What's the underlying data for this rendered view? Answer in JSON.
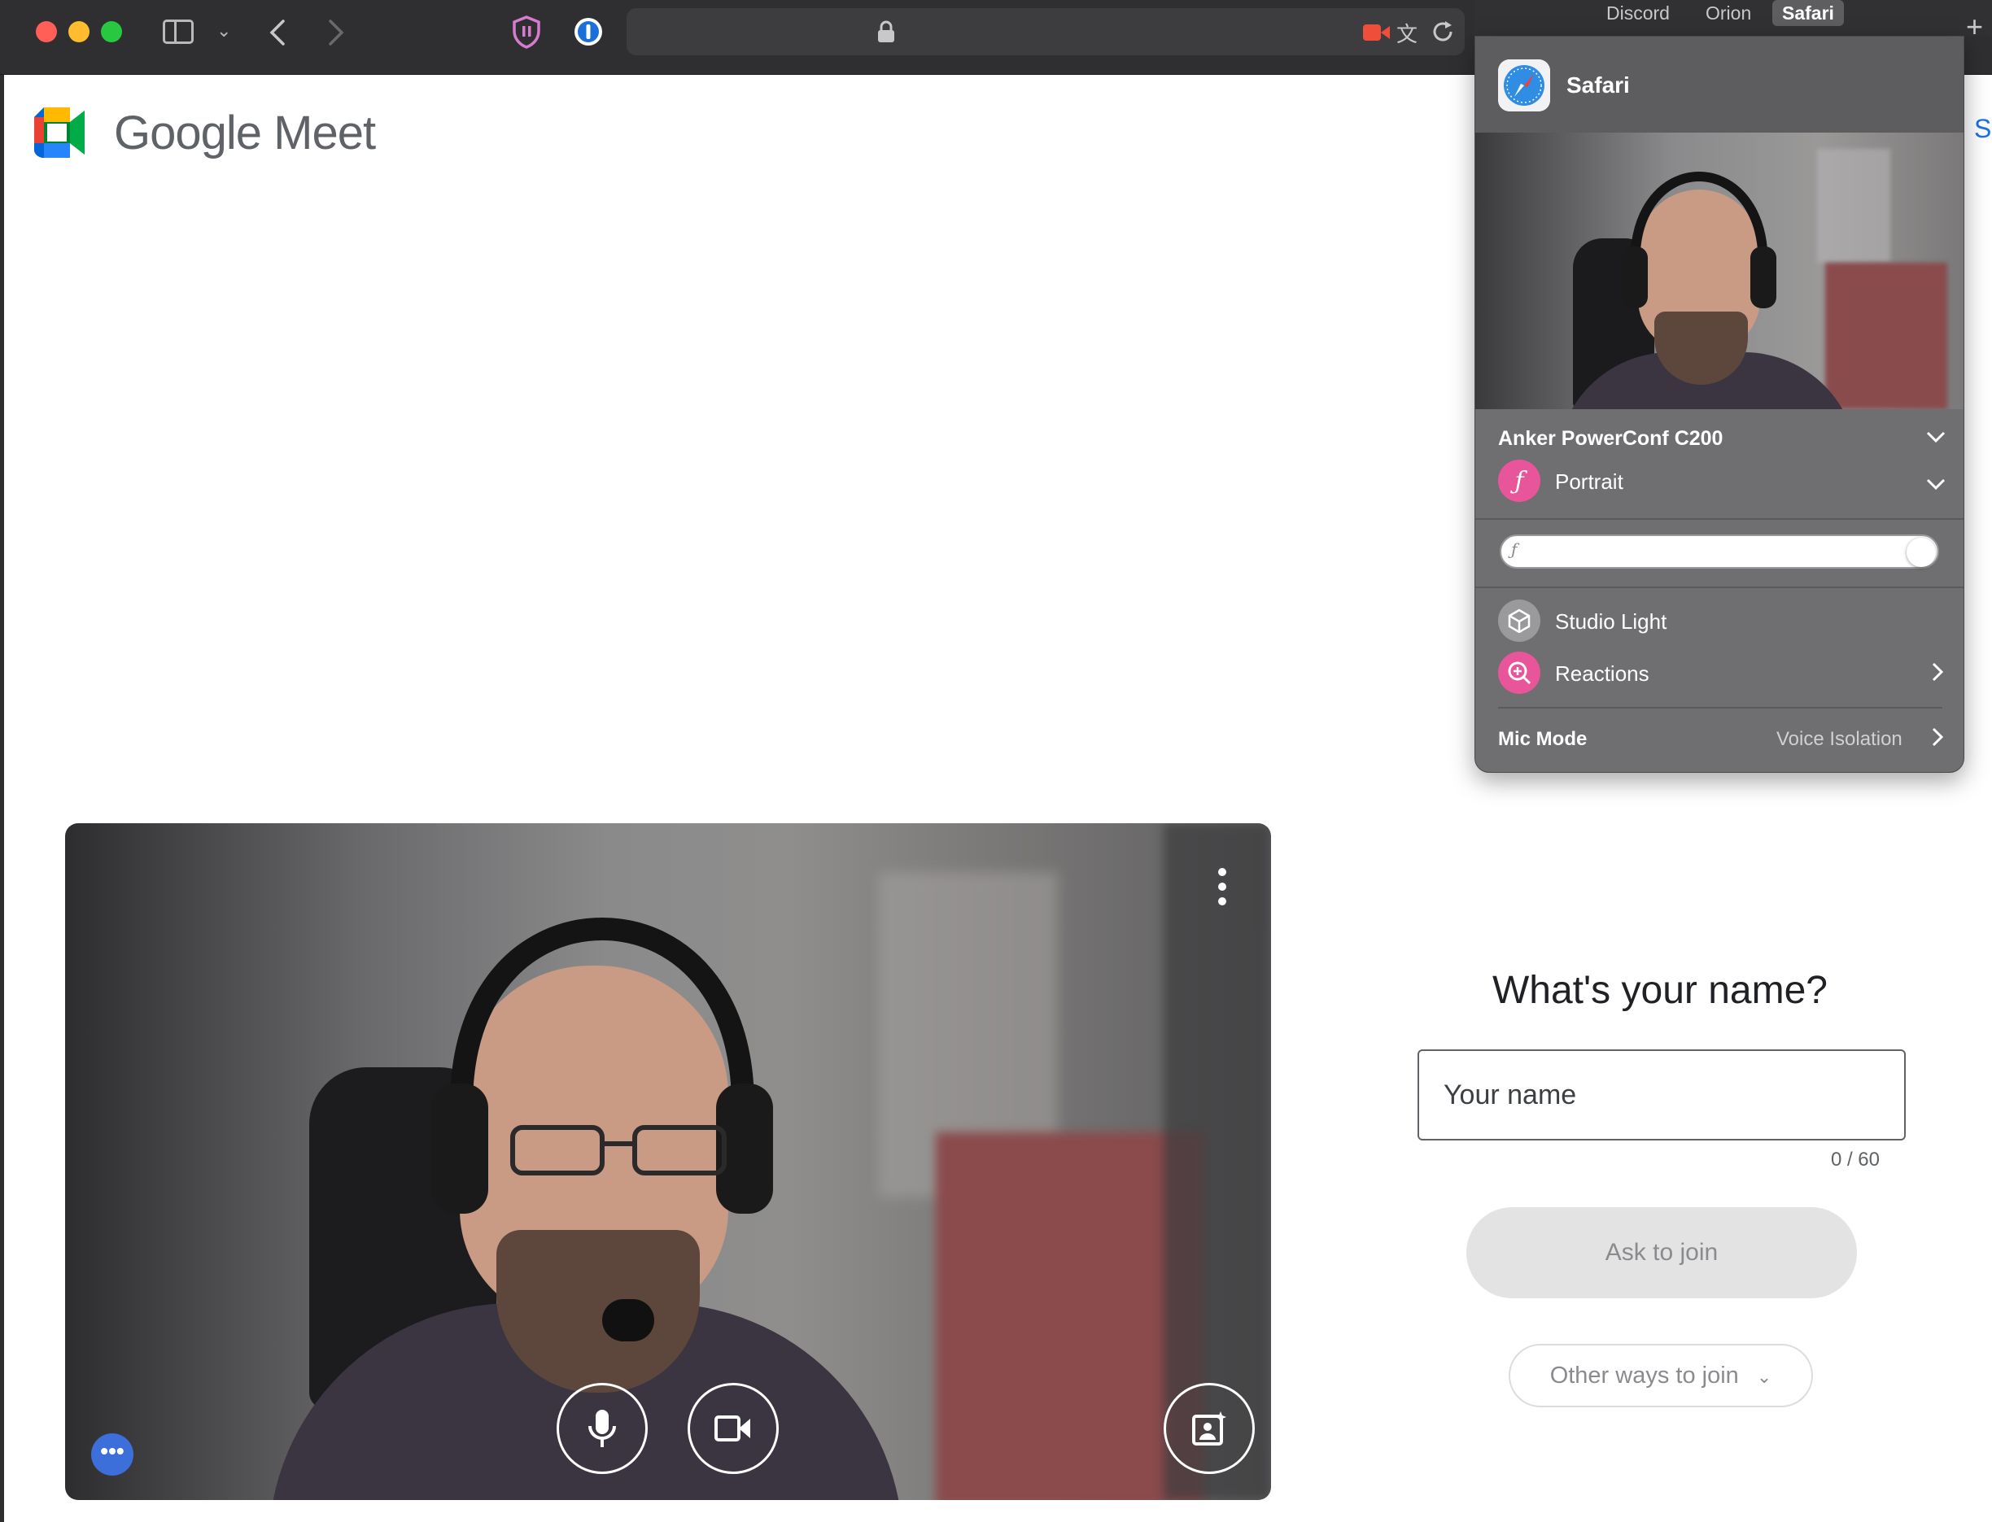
{
  "browser": {
    "window_controls": {
      "close_color": "#ff5f57",
      "minimize_color": "#febc2e",
      "zoom_color": "#28c840"
    },
    "icons": [
      "sidebar-icon",
      "chevron-down-icon",
      "back-icon",
      "forward-icon",
      "shield-extension-icon",
      "password-manager-icon",
      "lock-icon",
      "camera-in-use-icon",
      "translate-icon",
      "reload-icon"
    ]
  },
  "page": {
    "brand": {
      "name": "Google Meet",
      "edge_link": "Si"
    },
    "join": {
      "title": "What's your name?",
      "name_placeholder": "Your name",
      "name_value": "",
      "char_counter": "0 / 60",
      "ask_button": "Ask to join",
      "other_ways_button": "Other ways to join"
    },
    "video_controls": {
      "mic": "microphone-icon",
      "camera": "video-camera-icon",
      "effects": "visual-effects-icon",
      "more": "more-options-icon",
      "overflow": "kebab-menu-icon"
    }
  },
  "control_center": {
    "tabs": [
      "Discord",
      "Orion",
      "Safari"
    ],
    "active_tab": "Safari",
    "app_name": "Safari",
    "camera_name": "Anker PowerConf C200",
    "portrait_label": "Portrait",
    "portrait_slider_level": 1.0,
    "studio_light_label": "Studio Light",
    "reactions_label": "Reactions",
    "mic_mode_label": "Mic Mode",
    "mic_mode_value": "Voice Isolation",
    "accent_color": "#e8559a"
  }
}
